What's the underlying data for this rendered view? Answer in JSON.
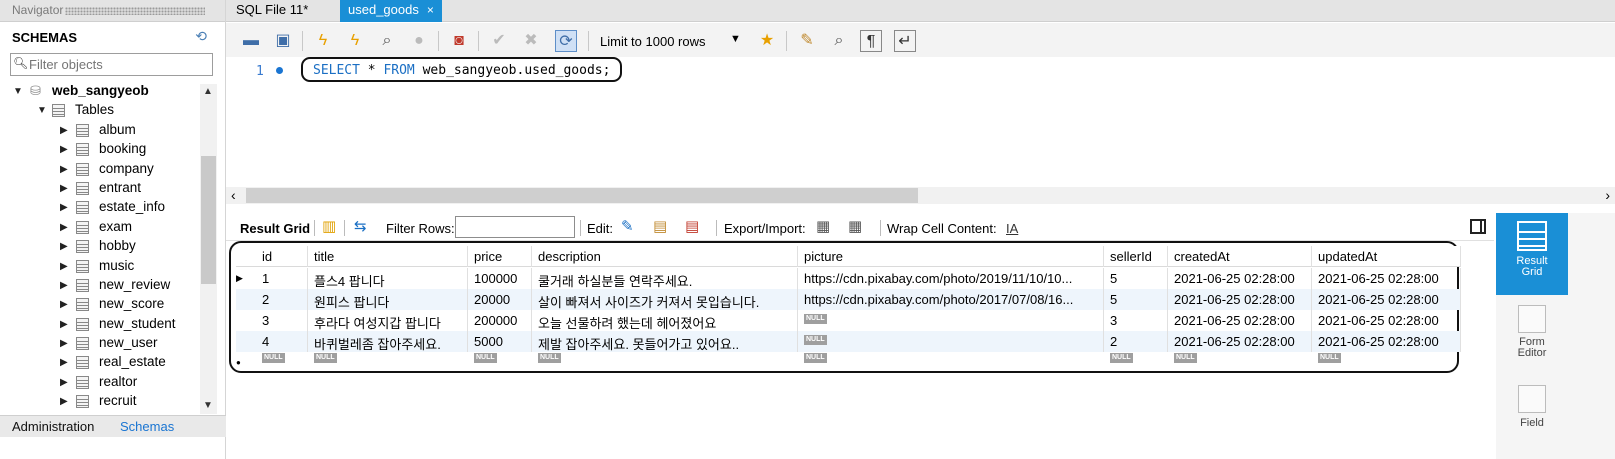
{
  "navigator": {
    "title": "Navigator",
    "schemas_label": "SCHEMAS",
    "filter_placeholder": "Filter objects",
    "schema_name": "web_sangyeob",
    "tables_label": "Tables",
    "tables": [
      "album",
      "booking",
      "company",
      "entrant",
      "estate_info",
      "exam",
      "hobby",
      "music",
      "new_review",
      "new_score",
      "new_student",
      "new_user",
      "real_estate",
      "realtor",
      "recruit"
    ],
    "bottom_tabs": [
      "Administration",
      "Schemas"
    ]
  },
  "editor_tabs": [
    {
      "label": "SQL File 11*",
      "active": false
    },
    {
      "label": "used_goods",
      "active": true,
      "close": "×"
    }
  ],
  "toolbar": {
    "limit_label": "Limit to 1000 rows"
  },
  "editor": {
    "line_number": "1",
    "sql_kw1": "SELECT",
    "sql_star": " * ",
    "sql_kw2": "FROM",
    "sql_rest": " web_sangyeob.used_goods;"
  },
  "result_toolbar": {
    "result_grid": "Result Grid",
    "filter_rows": "Filter Rows:",
    "edit": "Edit:",
    "export_import": "Export/Import:",
    "wrap_cell": "Wrap Cell Content:"
  },
  "grid": {
    "columns": [
      "id",
      "title",
      "price",
      "description",
      "picture",
      "sellerId",
      "createdAt",
      "updatedAt"
    ],
    "null_label": "NULL",
    "rows": [
      {
        "id": "1",
        "title": "플스4 팝니다",
        "price": "100000",
        "description": "쿨거래 하실분들 연락주세요.",
        "picture": "https://cdn.pixabay.com/photo/2019/11/10/10...",
        "sellerId": "5",
        "createdAt": "2021-06-25 02:28:00",
        "updatedAt": "2021-06-25 02:28:00"
      },
      {
        "id": "2",
        "title": "원피스 팝니다",
        "price": "20000",
        "description": "살이 빠져서 사이즈가 커져서 못입습니다.",
        "picture": "https://cdn.pixabay.com/photo/2017/07/08/16...",
        "sellerId": "5",
        "createdAt": "2021-06-25 02:28:00",
        "updatedAt": "2021-06-25 02:28:00"
      },
      {
        "id": "3",
        "title": "후라다 여성지갑 팝니다",
        "price": "200000",
        "description": "오늘 선물하려 했는데 헤어졌어요",
        "picture": null,
        "sellerId": "3",
        "createdAt": "2021-06-25 02:28:00",
        "updatedAt": "2021-06-25 02:28:00"
      },
      {
        "id": "4",
        "title": "바퀴벌레좀 잡아주세요.",
        "price": "5000",
        "description": "제발 잡아주세요. 못들어가고 있어요..",
        "picture": null,
        "sellerId": "2",
        "createdAt": "2021-06-25 02:28:00",
        "updatedAt": "2021-06-25 02:28:00"
      }
    ]
  },
  "side_panel": {
    "items": [
      {
        "label": "Result\nGrid",
        "active": true
      },
      {
        "label": "Form\nEditor",
        "active": false
      },
      {
        "label": "Field",
        "active": false
      }
    ]
  }
}
